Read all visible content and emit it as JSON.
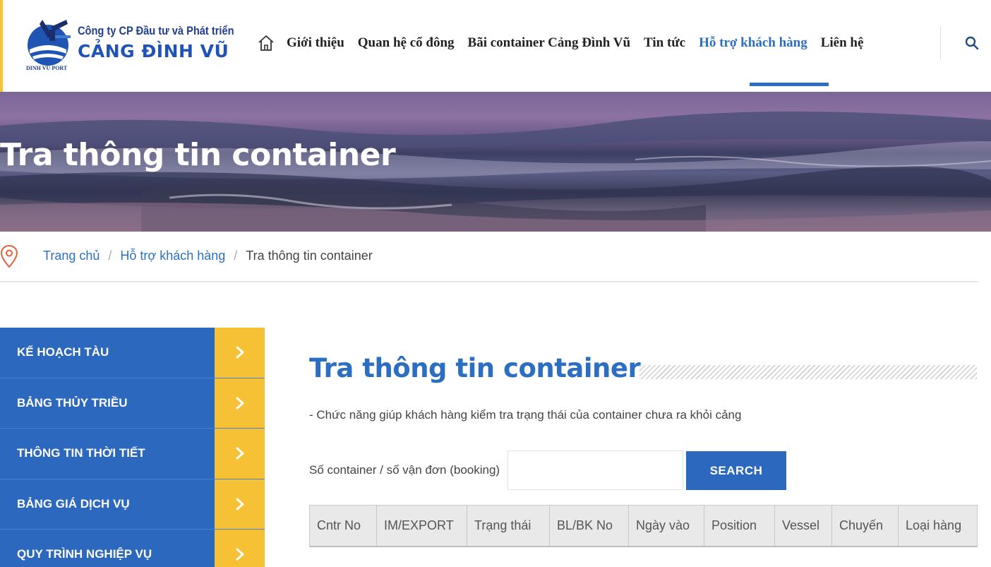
{
  "header": {
    "logo": {
      "line1": "Công ty CP Đầu tư và Phát triển",
      "line2": "CẢNG ĐÌNH VŨ",
      "sub": "DINH VU PORT"
    },
    "nav": [
      {
        "label": "Giới thiệu"
      },
      {
        "label": "Quan hệ cổ đông"
      },
      {
        "label": "Bãi container Cảng Đình Vũ"
      },
      {
        "label": "Tin tức"
      },
      {
        "label": "Hỗ trợ khách hàng",
        "active": true
      },
      {
        "label": "Liên hệ"
      }
    ]
  },
  "banner": {
    "title": "Tra thông tin container"
  },
  "breadcrumb": {
    "items": [
      "Trang chủ",
      "Hỗ trợ khách hàng"
    ],
    "current": "Tra thông tin container"
  },
  "sidebar": {
    "items": [
      {
        "label": "KẾ HOẠCH TÀU"
      },
      {
        "label": "BẢNG THỦY TRIỀU"
      },
      {
        "label": "THÔNG TIN THỜI TIẾT"
      },
      {
        "label": "BẢNG GIÁ DỊCH VỤ"
      },
      {
        "label": "QUY TRÌNH NGHIỆP VỤ"
      }
    ]
  },
  "main": {
    "title": "Tra thông tin container",
    "description": "- Chức năng giúp khách hàng kiểm tra trạng thái của container chưa ra khỏi cảng",
    "search": {
      "label": "Số container / số vận đơn (booking)",
      "value": "",
      "button_label": "SEARCH"
    },
    "table": {
      "columns": [
        "Cntr No",
        "IM/EXPORT",
        "Trạng thái",
        "BL/BK No",
        "Ngày vào",
        "Position",
        "Vessel",
        "Chuyến",
        "Loại hàng"
      ]
    }
  },
  "colors": {
    "primary": "#2b68be",
    "accent": "#f6c134",
    "link": "#2c6fc2"
  }
}
